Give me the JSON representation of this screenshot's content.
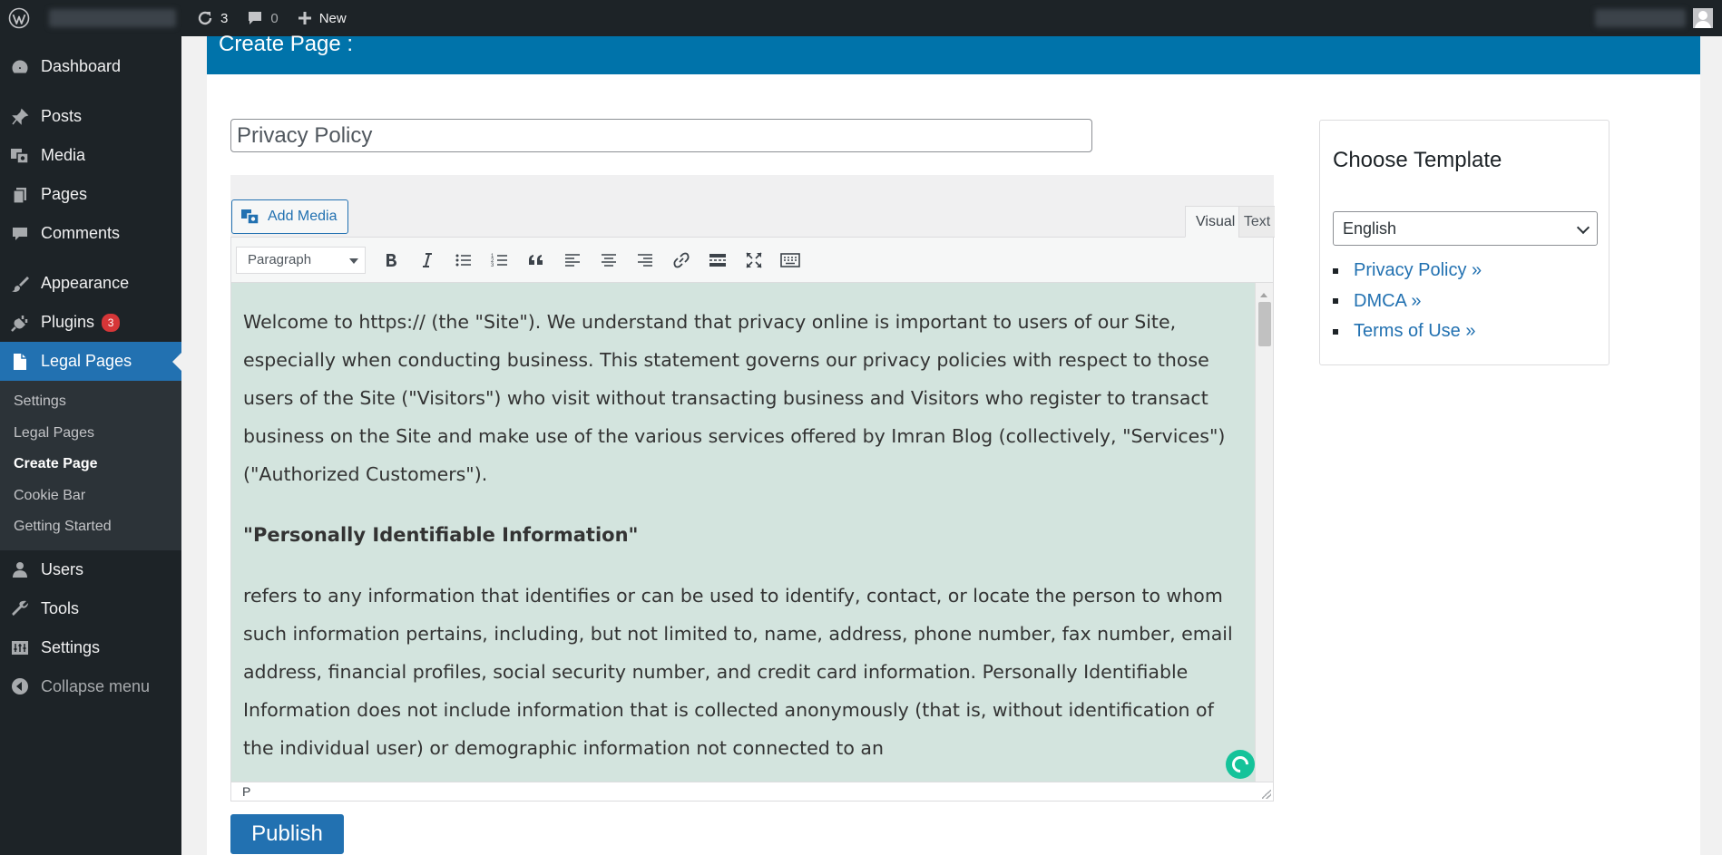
{
  "adminbar": {
    "updates_count": "3",
    "comments_count": "0",
    "new_label": "New"
  },
  "sidebar": {
    "items": [
      {
        "label": "Dashboard",
        "icon": "dashboard-icon"
      },
      {
        "label": "Posts",
        "icon": "pin-icon"
      },
      {
        "label": "Media",
        "icon": "media-icon"
      },
      {
        "label": "Pages",
        "icon": "pages-icon"
      },
      {
        "label": "Comments",
        "icon": "comment-icon"
      },
      {
        "label": "Appearance",
        "icon": "brush-icon"
      },
      {
        "label": "Plugins",
        "icon": "plugin-icon",
        "badge": "3"
      },
      {
        "label": "Legal Pages",
        "icon": "document-icon"
      },
      {
        "label": "Users",
        "icon": "user-icon"
      },
      {
        "label": "Tools",
        "icon": "wrench-icon"
      },
      {
        "label": "Settings",
        "icon": "sliders-icon"
      }
    ],
    "submenu": [
      "Settings",
      "Legal Pages",
      "Create Page",
      "Cookie Bar",
      "Getting Started"
    ],
    "collapse_label": "Collapse menu"
  },
  "page": {
    "header_title": "Create Page :",
    "title_value": "Privacy Policy"
  },
  "editor": {
    "add_media_label": "Add Media",
    "tab_visual": "Visual",
    "tab_text": "Text",
    "format_value": "Paragraph",
    "status_path": "P",
    "content": {
      "p1": "Welcome to https:// (the \"Site\"). We understand that privacy online is important to users of our Site, especially when conducting business. This statement governs our privacy policies with respect to those users of the Site (\"Visitors\") who visit without transacting business and Visitors who register to transact business on the Site and make use of the various services offered by Imran Blog (collectively, \"Services\") (\"Authorized Customers\").",
      "h1": "\"Personally Identifiable Information\"",
      "p2": "refers to any information that identifies or can be used to identify, contact, or locate the person to whom such information pertains, including, but not limited to, name, address, phone number, fax number, email address, financial profiles, social security number, and credit card information. Personally Identifiable Information does not include information that is collected anonymously (that is, without identification of the individual user) or demographic information not connected to an"
    }
  },
  "publish_label": "Publish",
  "template_box": {
    "title": "Choose Template",
    "language_value": "English",
    "links": [
      "Privacy Policy »",
      "DMCA »",
      "Terms of Use »"
    ]
  },
  "colors": {
    "admin_bar": "#1d2327",
    "accent": "#2271b1",
    "header_bar": "#0073aa",
    "editor_bg": "#d3e4de",
    "badge": "#d63638"
  }
}
